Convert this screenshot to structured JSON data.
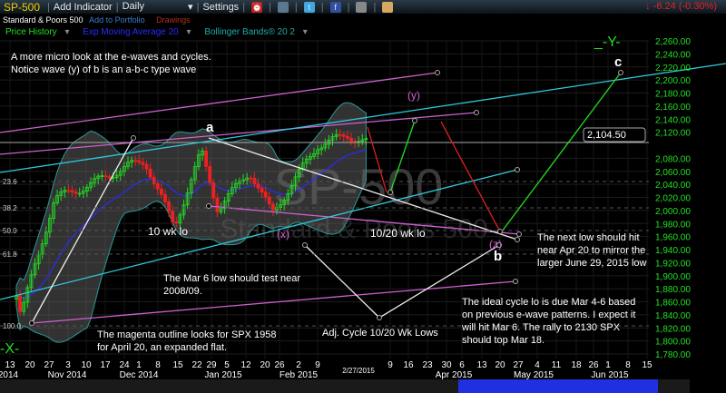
{
  "toolbar": {
    "symbol": "SP-500",
    "add_indicator": "Add Indicator",
    "interval": "Daily",
    "settings": "Settings",
    "change": "-6.24 (-0.30%)",
    "icons": [
      "alarm-clock-icon",
      "copy-icon",
      "twitter-icon",
      "facebook-icon",
      "binoculars-icon",
      "notes-icon"
    ]
  },
  "subheader": {
    "name": "Standard & Poors 500",
    "add_to_portfolio": "Add to Portfolio",
    "drawings": "Drawings"
  },
  "indicators": [
    {
      "label": "Price History",
      "color": "#22dd22"
    },
    {
      "label": "Exp Moving Average 20",
      "color": "#2222ff"
    },
    {
      "label": "Bollinger Bands® 20 2",
      "color": "#22aaaa"
    }
  ],
  "watermark": {
    "symbol": "SP-500",
    "name": "Standard & Poors 500"
  },
  "chart_data": {
    "type": "candlestick",
    "title": "SP-500 Daily",
    "ylim": [
      1780,
      2260
    ],
    "y_ticks": [
      "2,260.00",
      "2,240.00",
      "2,220.00",
      "2,200.00",
      "2,180.00",
      "2,160.00",
      "2,140.00",
      "2,120.00",
      "2,080.00",
      "2,060.00",
      "2,040.00",
      "2,020.00",
      "2,000.00",
      "1,980.00",
      "1,960.00",
      "1,940.00",
      "1,920.00",
      "1,900.00",
      "1,880.00",
      "1,860.00",
      "1,840.00",
      "1,820.00",
      "1,800.00",
      "1,780.00"
    ],
    "last_price": "2,104.50",
    "x_day_ticks": [
      "13",
      "20",
      "27",
      "3",
      "10",
      "17",
      "24",
      "1",
      "8",
      "15",
      "22",
      "29",
      "5",
      "12",
      "20",
      "26",
      "2",
      "9",
      "9",
      "16",
      "23",
      "30",
      "6",
      "13",
      "20",
      "27",
      "4",
      "11",
      "18",
      "26",
      "1",
      "8",
      "15"
    ],
    "x_month_ticks": [
      "2014",
      "Nov 2014",
      "Dec 2014",
      "Jan 2015",
      "Feb 2015",
      "Apr 2015",
      "May 2015",
      "Jun 2015"
    ],
    "current_date": "2/27/2015",
    "fib_levels": [
      "23.6",
      "38.2",
      "50.0",
      "61.8",
      "100.0"
    ],
    "price_path_keypoints": [
      [
        "Oct 13",
        1874
      ],
      [
        "Oct 15",
        1840
      ],
      [
        "Oct 31",
        2018
      ],
      [
        "Nov 14",
        2040
      ],
      [
        "Nov 28",
        2068
      ],
      [
        "Dec 5",
        2075
      ],
      [
        "Dec 16",
        1975
      ],
      [
        "Dec 29",
        2090
      ],
      [
        "Jan 6",
        2002
      ],
      [
        "Jan 22",
        2060
      ],
      [
        "Feb 2",
        1995
      ],
      [
        "Feb 17",
        2100
      ],
      [
        "Feb 25",
        2115
      ],
      [
        "Mar 2",
        2104
      ]
    ]
  },
  "annotations": {
    "intro": [
      "A more micro look at the e-waves and cycles.",
      "Notice wave (y) of b is an a-b-c type wave"
    ],
    "wave_a": "a",
    "wave_b": "b",
    "wave_c": "c",
    "wave_x": "(x)",
    "wave_y": "(y)",
    "wave_z": "(z)",
    "big_y": "_-Y-",
    "big_x": "-X-",
    "low_10wk": "10 wk lo",
    "low_10_20wk": "10/20 wk lo",
    "next_low": [
      "The next low should hit",
      "near Apr 20 to mirror the",
      "larger June 29, 2015 low"
    ],
    "mar6": [
      "The Mar 6 low should test near",
      "2008/09."
    ],
    "ideal_cycle": [
      "The ideal cycle lo is due Mar 4-6 based",
      "on previous e-wave patterns. I expect it",
      "will hit Mar 6.  The rally to 2130 SPX",
      "should top Mar 18."
    ],
    "magenta": [
      "The magenta outline looks for SPX 1958",
      "for April 20, an expanded flat."
    ],
    "adj_cycle": "Adj. Cycle 10/20 Wk Lows"
  },
  "colors": {
    "up": "#22dd22",
    "down": "#ee2020",
    "ema": "#2a2aff",
    "bollinger": "#2a9a9a",
    "magenta": "#d060d0",
    "cyan": "#30c8d8",
    "axis": "#23e023"
  }
}
